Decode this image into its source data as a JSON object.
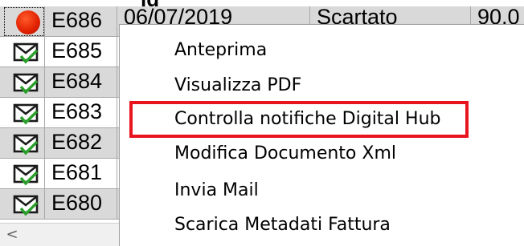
{
  "header_fragment": "ig",
  "rows": [
    {
      "id": "E686",
      "date": "06/07/2019",
      "status": "Scartato",
      "amount": "90,0",
      "icon": "red-dot-icon",
      "alt": true
    },
    {
      "id": "E685",
      "icon": "envelope-check-icon",
      "alt": false
    },
    {
      "id": "E684",
      "icon": "envelope-check-icon",
      "alt": true
    },
    {
      "id": "E683",
      "icon": "envelope-check-icon",
      "alt": false
    },
    {
      "id": "E682",
      "icon": "envelope-check-icon",
      "alt": true
    },
    {
      "id": "E681",
      "icon": "envelope-check-icon",
      "alt": false
    },
    {
      "id": "E680",
      "icon": "envelope-check-icon",
      "alt": true
    }
  ],
  "context_menu": {
    "items": [
      "Anteprima",
      "Visualizza PDF",
      "Controlla notifiche Digital Hub",
      "Modifica Documento Xml",
      "Invia Mail",
      "Scarica Metadati Fattura"
    ],
    "highlighted_index": 2,
    "highlight_color": "#e8141e"
  },
  "scrollbar": {
    "left_arrow": "<"
  },
  "colors": {
    "row_alt": "#d9d9d9",
    "status_red": "#e02000",
    "check_green": "#2aa02a"
  }
}
